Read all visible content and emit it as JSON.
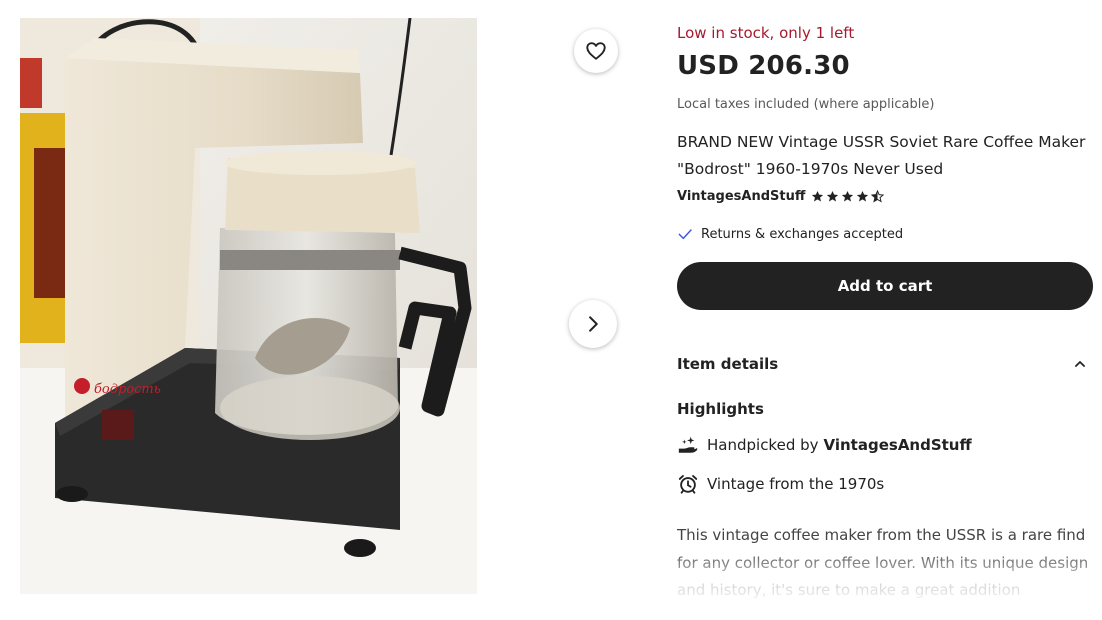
{
  "listing": {
    "stock_notice": "Low in stock, only 1 left",
    "price": "USD 206.30",
    "tax_note": "Local taxes included (where applicable)",
    "title": "BRAND NEW Vintage USSR Soviet Rare Coffee Maker \"Bodrost\" 1960-1970s Never Used",
    "shop_name": "VintagesAndStuff",
    "rating_stars": 4.5,
    "returns_note": "Returns & exchanges accepted",
    "add_to_cart_label": "Add to cart"
  },
  "photo": {
    "brand_mark": "бодрость"
  },
  "item_details": {
    "heading": "Item details",
    "expanded": true,
    "highlights_heading": "Highlights",
    "handpicked_prefix": "Handpicked by",
    "handpicked_shop": "VintagesAndStuff",
    "vintage_note": "Vintage from the 1970s",
    "description": "This vintage coffee maker from the USSR is a rare find for any collector or coffee lover. With its unique design and history, it's sure to make a great addition"
  },
  "icons": {
    "favorite": "heart-icon",
    "next": "chevron-right-icon",
    "rating": "star-icon",
    "returns": "check-icon",
    "collapse": "chevron-up-icon",
    "handpicked": "hand-sparkle-icon",
    "vintage": "alarm-clock-icon"
  },
  "colors": {
    "stock_notice": "#a61a2e",
    "cart_button": "#222222",
    "check": "#3b5bdb"
  }
}
